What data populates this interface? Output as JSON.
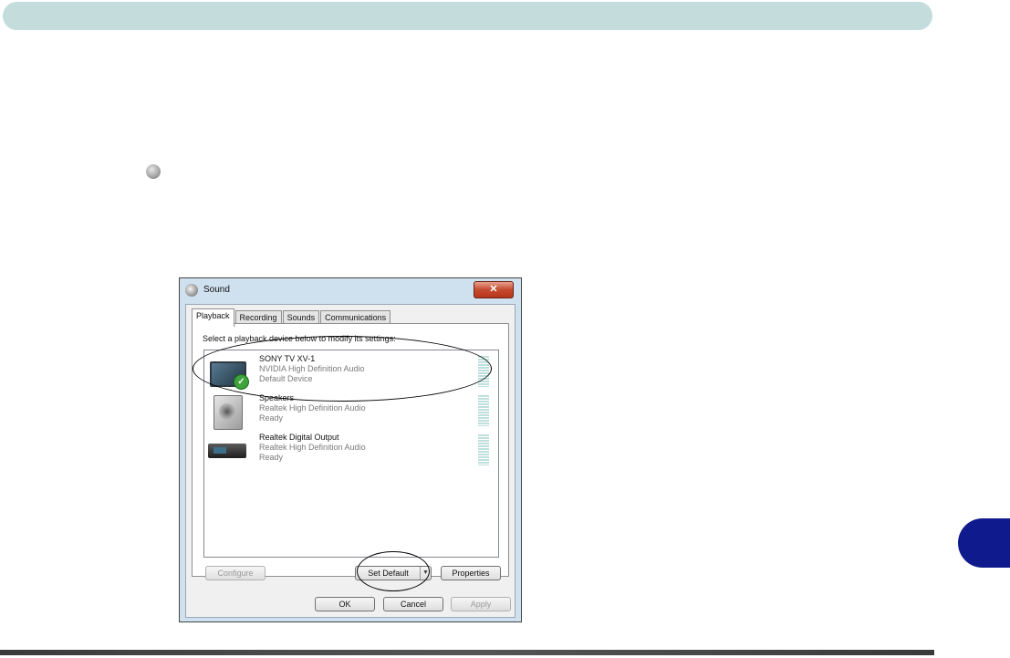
{
  "dialog": {
    "title": "Sound",
    "close_label": "✕",
    "tabs": [
      {
        "label": "Playback"
      },
      {
        "label": "Recording"
      },
      {
        "label": "Sounds"
      },
      {
        "label": "Communications"
      }
    ],
    "instruction": "Select a playback device below to modify its settings:",
    "devices": [
      {
        "name": "SONY TV XV-1",
        "driver": "NVIDIA High Definition Audio",
        "status": "Default Device",
        "icon": "tv-icon"
      },
      {
        "name": "Speakers",
        "driver": "Realtek High Definition Audio",
        "status": "Ready",
        "icon": "speaker-icon"
      },
      {
        "name": "Realtek Digital Output",
        "driver": "Realtek High Definition Audio",
        "status": "Ready",
        "icon": "digital-output-icon"
      }
    ],
    "buttons": {
      "configure": "Configure",
      "set_default": "Set Default",
      "properties": "Properties",
      "ok": "OK",
      "cancel": "Cancel",
      "apply": "Apply"
    }
  },
  "colors": {
    "top_bar": "#c5dcdc",
    "chapter_tab": "#0f1b8c"
  }
}
